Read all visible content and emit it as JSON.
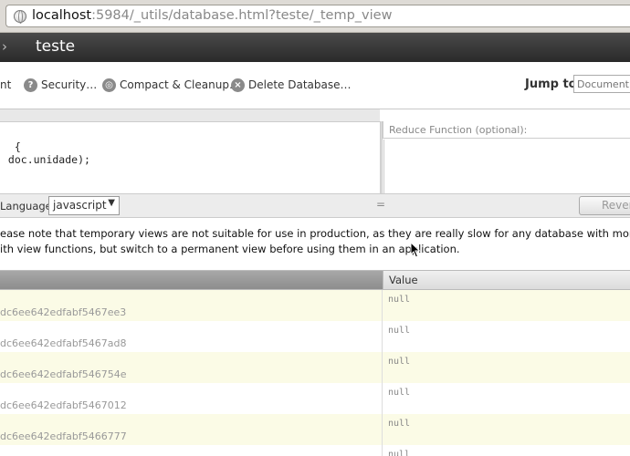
{
  "browser": {
    "url_host": "localhost",
    "url_rest": ":5984/_utils/database.html?teste/_temp_view"
  },
  "header": {
    "title": "teste"
  },
  "toolbar": {
    "item_partial": "nt",
    "security": "Security…",
    "compact": "Compact & Cleanup…",
    "delete": "Delete Database…",
    "jump_label": "Jump to:",
    "jump_placeholder": "Document ID"
  },
  "editor": {
    "map_lines": [
      "  {",
      " doc.unidade);"
    ],
    "reduce_label": "Reduce Function (optional):"
  },
  "language": {
    "label": "Language:",
    "value": "javascript",
    "revert": "Revert"
  },
  "note": {
    "line1": "ease note that temporary views are not suitable for use in production, as they are really slow for any database with more than a few dozen documents.",
    "line2": "ith view functions, but switch to a permanent view before using them in an application."
  },
  "results": {
    "value_header": "Value",
    "rows": [
      {
        "key": "dc6ee642edfabf5467ee3",
        "value": "null"
      },
      {
        "key": "dc6ee642edfabf5467ad8",
        "value": "null"
      },
      {
        "key": "dc6ee642edfabf546754e",
        "value": "null"
      },
      {
        "key": "dc6ee642edfabf5467012",
        "value": "null"
      },
      {
        "key": "dc6ee642edfabf5466777",
        "value": "null"
      },
      {
        "key": "",
        "value": "null"
      }
    ]
  }
}
